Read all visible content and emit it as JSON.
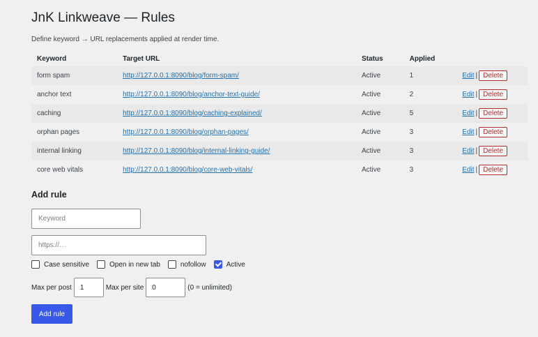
{
  "page": {
    "title": "JnK Linkweave — Rules",
    "description": "Define keyword → URL replacements applied at render time."
  },
  "table": {
    "headers": {
      "keyword": "Keyword",
      "target": "Target URL",
      "status": "Status",
      "applied": "Applied"
    },
    "rows": [
      {
        "keyword": "form spam",
        "url": "http://127.0.0.1:8090/blog/form-spam/",
        "status": "Active",
        "applied": "1",
        "edit": "Edit",
        "sep": "|",
        "delete": "Delete"
      },
      {
        "keyword": "anchor text",
        "url": "http://127.0.0.1:8090/blog/anchor-text-guide/",
        "status": "Active",
        "applied": "2",
        "edit": "Edit",
        "sep": "|",
        "delete": "Delete"
      },
      {
        "keyword": "caching",
        "url": "http://127.0.0.1:8090/blog/caching-explained/",
        "status": "Active",
        "applied": "5",
        "edit": "Edit",
        "sep": "|",
        "delete": "Delete"
      },
      {
        "keyword": "orphan pages",
        "url": "http://127.0.0.1:8090/blog/orphan-pages/",
        "status": "Active",
        "applied": "3",
        "edit": "Edit",
        "sep": "|",
        "delete": "Delete"
      },
      {
        "keyword": "internal linking",
        "url": "http://127.0.0.1:8090/blog/internal-linking-guide/",
        "status": "Active",
        "applied": "3",
        "edit": "Edit",
        "sep": "|",
        "delete": "Delete"
      },
      {
        "keyword": "core web vitals",
        "url": "http://127.0.0.1:8090/blog/core-web-vitals/",
        "status": "Active",
        "applied": "3",
        "edit": "Edit",
        "sep": "|",
        "delete": "Delete"
      }
    ]
  },
  "form": {
    "heading": "Add rule",
    "keyword_placeholder": "Keyword",
    "url_placeholder": "https://…",
    "checkboxes": [
      {
        "label": "Case sensitive",
        "checked": false
      },
      {
        "label": "Open in new tab",
        "checked": false
      },
      {
        "label": "nofollow",
        "checked": false
      },
      {
        "label": "Active",
        "checked": true
      }
    ],
    "max_per_post_label": "Max per post",
    "max_per_post_value": "1",
    "max_per_site_label": "Max per site",
    "max_per_site_value": "0",
    "unlimited_hint": "(0 = unlimited)",
    "submit_label": "Add rule"
  },
  "colors": {
    "accent": "#3858e9",
    "link": "#2271b1",
    "danger": "#b32d2e",
    "background": "#f0f0f1"
  }
}
